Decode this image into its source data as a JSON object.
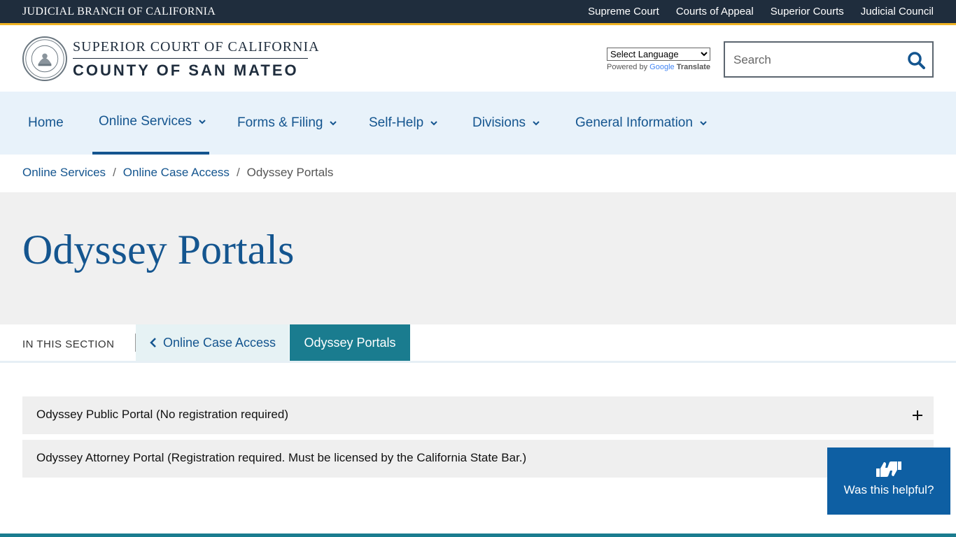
{
  "topbar": {
    "brand": "JUDICIAL BRANCH OF CALIFORNIA",
    "links": [
      "Supreme Court",
      "Courts of Appeal",
      "Superior Courts",
      "Judicial Council"
    ]
  },
  "header": {
    "logo_line1": "SUPERIOR COURT OF CALIFORNIA",
    "logo_line2": "COUNTY OF SAN MATEO",
    "language_select": "Select Language",
    "powered_by": "Powered by",
    "google": "Google",
    "translate": "Translate",
    "search_placeholder": "Search"
  },
  "nav": {
    "items": [
      "Home",
      "Online Services",
      "Forms & Filing",
      "Self-Help",
      "Divisions",
      "General Information"
    ]
  },
  "breadcrumb": {
    "items": [
      "Online Services",
      "Online Case Access",
      "Odyssey Portals"
    ],
    "separator": "/"
  },
  "page": {
    "title": "Odyssey Portals"
  },
  "section": {
    "label": "IN THIS SECTION",
    "back_link": "Online Case Access",
    "current": "Odyssey Portals"
  },
  "accordions": [
    "Odyssey Public Portal (No registration required)",
    "Odyssey Attorney Portal (Registration required. Must be licensed by the California State Bar.)"
  ],
  "helpful": {
    "label": "Was this helpful?"
  },
  "colors": {
    "topbar": "#1f2d3d",
    "accent": "#f0b323",
    "link": "#14558f",
    "nav_bg": "#e8f2fa",
    "tab_active": "#1a7c8f",
    "helpful_bg": "#0e5fa3"
  }
}
